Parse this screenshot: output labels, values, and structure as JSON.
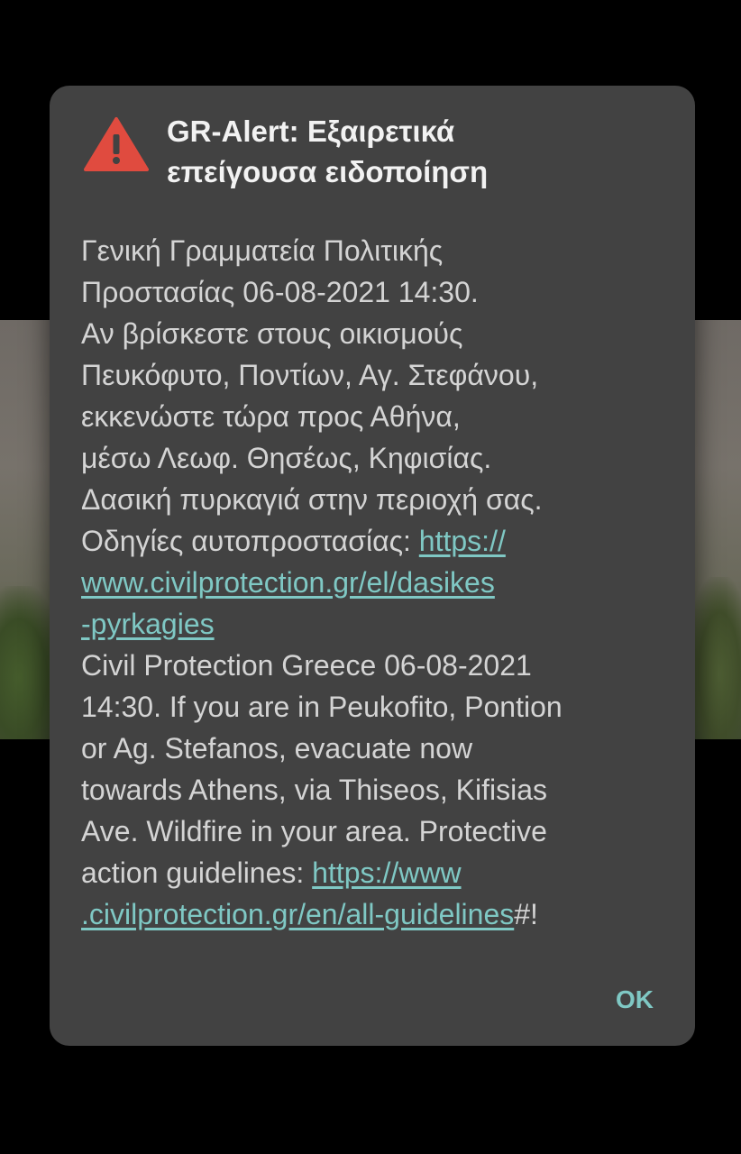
{
  "dialog": {
    "title_lines": [
      "GR-Alert: Εξαιρετικά",
      "επείγουσα ειδοποίηση"
    ],
    "body": {
      "line1": "Γενική Γραμματεία Πολιτικής",
      "line2": "Προστασίας 06-08-2021 14:30.",
      "line3": "Αν βρίσκεστε στους οικισμούς",
      "line4": "Πευκόφυτο, Ποντίων, Αγ. Στεφάνου,",
      "line5": "εκκενώστε τώρα προς Αθήνα,",
      "line6": "μέσω Λεωφ. Θησέως, Κηφισίας.",
      "line7": "Δασική πυρκαγιά στην περιοχή σας.",
      "line8_text": "Οδηγίες αυτοπροστασίας: ",
      "link_gr_part1": "https://",
      "link_gr_part2": "www.civilprotection.gr/el/dasikes",
      "link_gr_part3": "-pyrkagies",
      "line11": "Civil Protection Greece 06-08-2021",
      "line12": "14:30. If you are in Peukofito, Pontion",
      "line13": "or Ag. Stefanos, evacuate now",
      "line14": "towards Athens, via Thiseos, Kifisias",
      "line15": "Ave. Wildfire in your area. Protective",
      "line16_text": "action guidelines: ",
      "link_en_part1": "https://www",
      "link_en_part2": ".civilprotection.gr/en/all-guidelines",
      "line17_suffix": "#!"
    },
    "ok_label": "OK"
  },
  "icon": "warning-triangle-icon",
  "colors": {
    "dialog_bg": "#424242",
    "accent_link": "#7fc8c4",
    "warning_red": "#e04b3f"
  }
}
